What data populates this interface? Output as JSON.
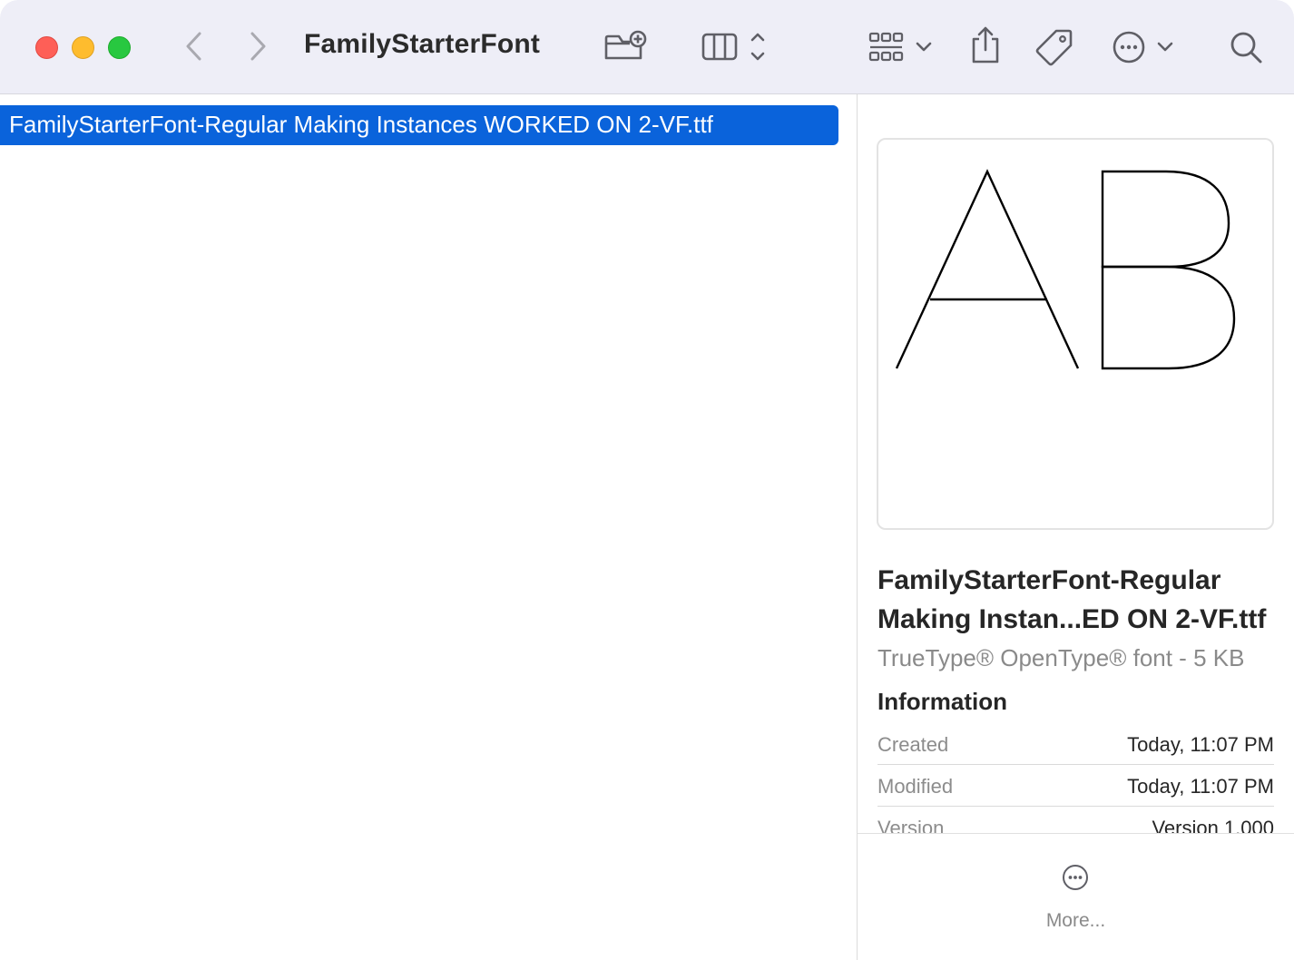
{
  "window": {
    "title": "FamilyStarterFont"
  },
  "toolbar": {
    "icons": [
      "chevron-left-icon",
      "chevron-right-icon",
      "new-folder-icon",
      "column-view-icon",
      "group-icon",
      "share-icon",
      "tag-icon",
      "more-actions-icon",
      "search-icon"
    ]
  },
  "file_list": {
    "items": [
      {
        "name": "FamilyStarterFont-Regular Making Instances WORKED ON 2-VF.ttf",
        "selected": true
      }
    ]
  },
  "preview": {
    "glyph_sample": "AB",
    "file_name": "FamilyStarterFont-Regular Making Instan...ED ON 2-VF.ttf",
    "file_type": "TrueType® OpenType® font - 5 KB",
    "info_heading": "Information",
    "info": [
      {
        "label": "Created",
        "value": "Today, 11:07 PM"
      },
      {
        "label": "Modified",
        "value": "Today, 11:07 PM"
      },
      {
        "label": "Version",
        "value": "Version 1.000"
      }
    ],
    "more_label": "More..."
  },
  "colors": {
    "selection": "#0a63db",
    "toolbar_bg": "#eeeef7",
    "close": "#fe5f57",
    "minimize": "#febc2e",
    "zoom": "#28c840"
  }
}
